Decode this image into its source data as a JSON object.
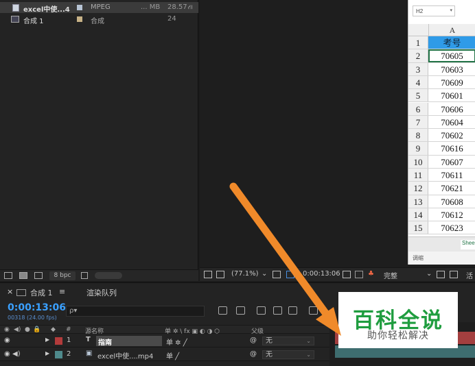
{
  "project": {
    "items": [
      {
        "name": "excel中使...4",
        "type": "MPEG",
        "size": "... MB",
        "size2": "28.57",
        "swatch": "#b7c4d4"
      },
      {
        "name": "合成 1",
        "type": "合成",
        "size": "",
        "size2": "24",
        "swatch": "#c7b287"
      }
    ],
    "footer": {
      "bpc": "8 bpc"
    }
  },
  "excel": {
    "name_box": "H2",
    "column_header": "A",
    "rows": [
      {
        "n": "1",
        "v": "考号"
      },
      {
        "n": "2",
        "v": "70605"
      },
      {
        "n": "3",
        "v": "70603"
      },
      {
        "n": "4",
        "v": "70609"
      },
      {
        "n": "5",
        "v": "70601"
      },
      {
        "n": "6",
        "v": "70606"
      },
      {
        "n": "7",
        "v": "70604"
      },
      {
        "n": "8",
        "v": "70602"
      },
      {
        "n": "9",
        "v": "70616"
      },
      {
        "n": "10",
        "v": "70607"
      },
      {
        "n": "11",
        "v": "70611"
      },
      {
        "n": "12",
        "v": "70621"
      },
      {
        "n": "13",
        "v": "70608"
      },
      {
        "n": "14",
        "v": "70612"
      },
      {
        "n": "15",
        "v": "70623"
      }
    ],
    "sheet_tab": "Shee",
    "status": "调缩"
  },
  "viewer_toolbar": {
    "zoom": "(77.1%)",
    "timecode": "0:00:13:06",
    "resolution": "完整",
    "active_camera": "活"
  },
  "timeline": {
    "comp_tab": "合成 1",
    "render_queue_tab": "渲染队列",
    "current_time": "0:00:13:06",
    "frame_info": "00318 (24.00 fps)",
    "search_placeholder": "ρ▾",
    "columns": {
      "num": "#",
      "source_name": "源名称",
      "switches": "单 ✲ \\ fx ▣ ◐ ◑ ⬡",
      "parent": "父级"
    },
    "layers": [
      {
        "num": "1",
        "type": "T",
        "name": "指南",
        "switches": "单 ✲ ╱",
        "parent": "无",
        "label_color": "#b33b3b"
      },
      {
        "num": "2",
        "type": "▣",
        "name": "excel中使....mp4",
        "switches": "单   ╱",
        "parent": "无",
        "label_color": "#4f8a8c"
      }
    ]
  },
  "watermark": {
    "title": "百科全说",
    "subtitle": "助你轻松解决"
  },
  "colors": {
    "accent_time": "#3aa0ff",
    "arrow": "#f08a2a",
    "watermark_green": "#1f9d3f"
  }
}
